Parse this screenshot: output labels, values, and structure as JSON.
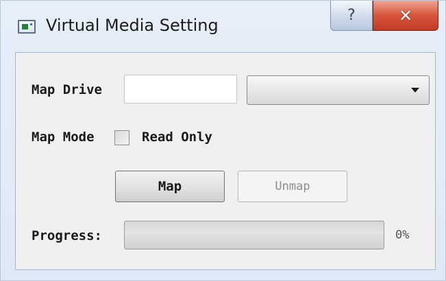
{
  "window": {
    "title": "Virtual Media Setting",
    "help_label": "?",
    "close_label": "✕"
  },
  "icons": {
    "app": "app-window-icon",
    "help": "question-mark-icon",
    "close": "close-icon",
    "dropdown": "chevron-down-icon"
  },
  "form": {
    "map_drive_label": "Map Drive",
    "map_drive_value": "",
    "drive_select_value": "",
    "map_mode_label": "Map Mode",
    "read_only_label": "Read Only",
    "read_only_checked": false,
    "map_button": "Map",
    "unmap_button": "Unmap",
    "unmap_enabled": false,
    "progress_label": "Progress:",
    "progress_value": 0,
    "progress_text": "0%"
  },
  "colors": {
    "close_button": "#c23b22",
    "titlebar": "#dfe9f5",
    "client_bg": "#f0f0f0"
  }
}
